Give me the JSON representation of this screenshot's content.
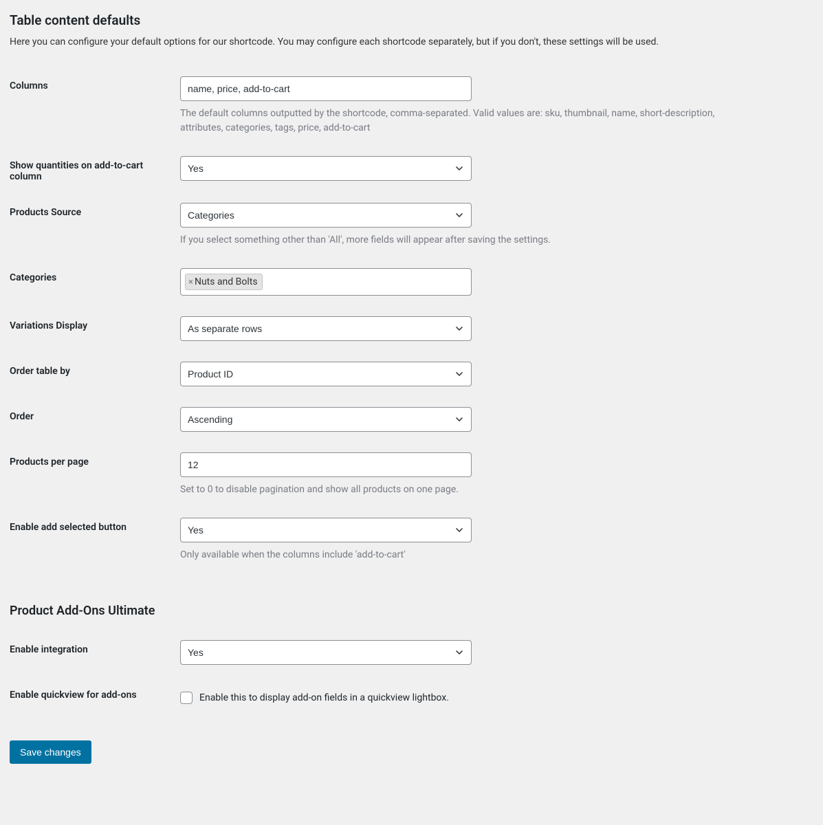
{
  "section1": {
    "title": "Table content defaults",
    "desc": "Here you can configure your default options for our shortcode. You may configure each shortcode separately, but if you don't, these settings will be used."
  },
  "columns": {
    "label": "Columns",
    "value": "name, price, add-to-cart",
    "help": "The default columns outputted by the shortcode, comma-separated. Valid values are: sku, thumbnail, name, short-description, attributes, categories, tags, price, add-to-cart"
  },
  "show_qty": {
    "label": "Show quantities on add-to-cart column",
    "value": "Yes"
  },
  "products_source": {
    "label": "Products Source",
    "value": "Categories",
    "help": "If you select something other than 'All', more fields will appear after saving the settings."
  },
  "categories": {
    "label": "Categories",
    "tags": [
      "Nuts and Bolts"
    ]
  },
  "variations_display": {
    "label": "Variations Display",
    "value": "As separate rows"
  },
  "order_by": {
    "label": "Order table by",
    "value": "Product ID"
  },
  "order": {
    "label": "Order",
    "value": "Ascending"
  },
  "per_page": {
    "label": "Products per page",
    "value": "12",
    "help": "Set to 0 to disable pagination and show all products on one page."
  },
  "add_selected": {
    "label": "Enable add selected button",
    "value": "Yes",
    "help": "Only available when the columns include 'add-to-cart'"
  },
  "section2": {
    "title": "Product Add-Ons Ultimate"
  },
  "enable_integration": {
    "label": "Enable integration",
    "value": "Yes"
  },
  "quickview": {
    "label": "Enable quickview for add-ons",
    "desc": "Enable this to display add-on fields in a quickview lightbox."
  },
  "save_label": "Save changes"
}
